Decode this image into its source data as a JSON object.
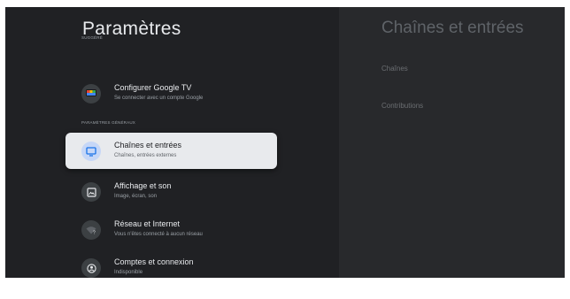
{
  "left": {
    "title": "Paramètres",
    "section_suggested": "Suggéré",
    "section_general": "Paramètres généraux",
    "items": [
      {
        "label": "Configurer Google TV",
        "sub": "Se connecter avec un compte Google",
        "icon": "google-tv-icon"
      },
      {
        "label": "Chaînes et entrées",
        "sub": "Chaînes, entrées externes",
        "icon": "tv-icon",
        "focused": true
      },
      {
        "label": "Affichage et son",
        "sub": "Image, écran, son",
        "icon": "image-icon"
      },
      {
        "label": "Réseau et Internet",
        "sub": "Vous n'êtes connecté à aucun réseau",
        "icon": "wifi-off-icon"
      },
      {
        "label": "Comptes et connexion",
        "sub": "Indisponible",
        "icon": "account-icon"
      }
    ]
  },
  "right": {
    "title": "Chaînes et entrées",
    "items": [
      "Chaînes",
      "Contributions"
    ]
  },
  "colors": {
    "background": "#202124",
    "panel": "#28292c",
    "focused": "#e8eaed",
    "focus_icon_bg": "#c6d7f7",
    "accent_blue": "#4285f4"
  }
}
